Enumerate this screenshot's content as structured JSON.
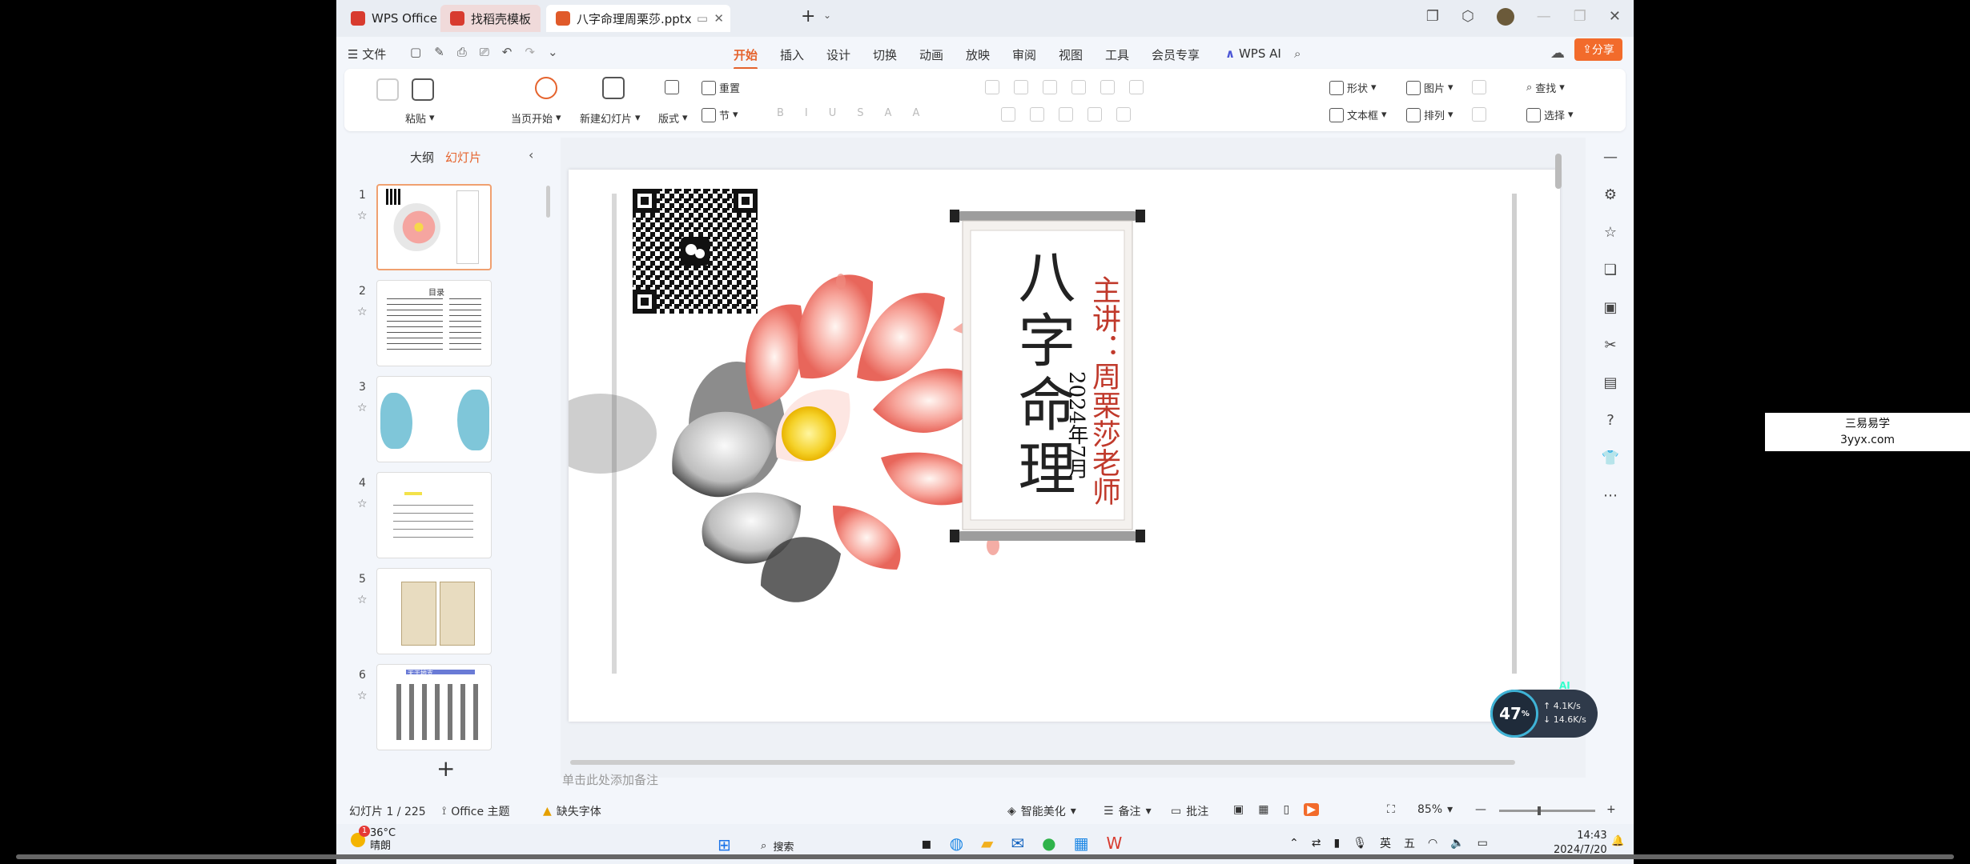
{
  "tabs": [
    {
      "label": "WPS Office",
      "color": "#d83b2f"
    },
    {
      "label": "找稻壳模板",
      "color": "#d83b2f"
    },
    {
      "label": "八字命理周栗莎.pptx",
      "color": "#e05a2a"
    }
  ],
  "menu": {
    "file": "文件",
    "items": [
      "开始",
      "插入",
      "设计",
      "切换",
      "动画",
      "放映",
      "审阅",
      "视图",
      "工具",
      "会员专享",
      "WPS AI"
    ],
    "active": "开始",
    "share": "分享"
  },
  "ribbon": {
    "paste": "粘贴",
    "play_from_current": "当页开始",
    "new_slide": "新建幻灯片",
    "layout": "版式",
    "reset": "重置",
    "section": "节",
    "shape": "形状",
    "picture": "图片",
    "find": "查找",
    "textbox": "文本框",
    "arrange": "排列",
    "select": "选择"
  },
  "panel": {
    "tab_outline": "大纲",
    "tab_slides": "幻灯片",
    "slide_numbers": [
      "1",
      "2",
      "3",
      "4",
      "5",
      "6"
    ],
    "thumb2_title": "目录",
    "thumb6_title": "天干地支"
  },
  "slide": {
    "title": "八字命理",
    "presenter": "主讲：周栗莎老师",
    "date": "2024年7月"
  },
  "notes_placeholder": "单击此处添加备注",
  "status": {
    "slide_count": "幻灯片 1 / 225",
    "theme": "Office 主题",
    "missing_font": "缺失字体",
    "smart_beautify": "智能美化",
    "notes": "备注",
    "comments": "批注",
    "zoom": "85%"
  },
  "taskbar": {
    "temperature": "36°C",
    "weather": "晴朗",
    "badge": "1",
    "search": "搜索",
    "ime_lang": "英",
    "ime_mode": "五",
    "time": "14:43",
    "date": "2024/7/20"
  },
  "network": {
    "percent": "47",
    "unit": "%",
    "up": "4.1K/s",
    "down": "14.6K/s",
    "ai": "AI"
  },
  "watermark": {
    "line1": "三易易学",
    "line2": "3yyx.com"
  }
}
